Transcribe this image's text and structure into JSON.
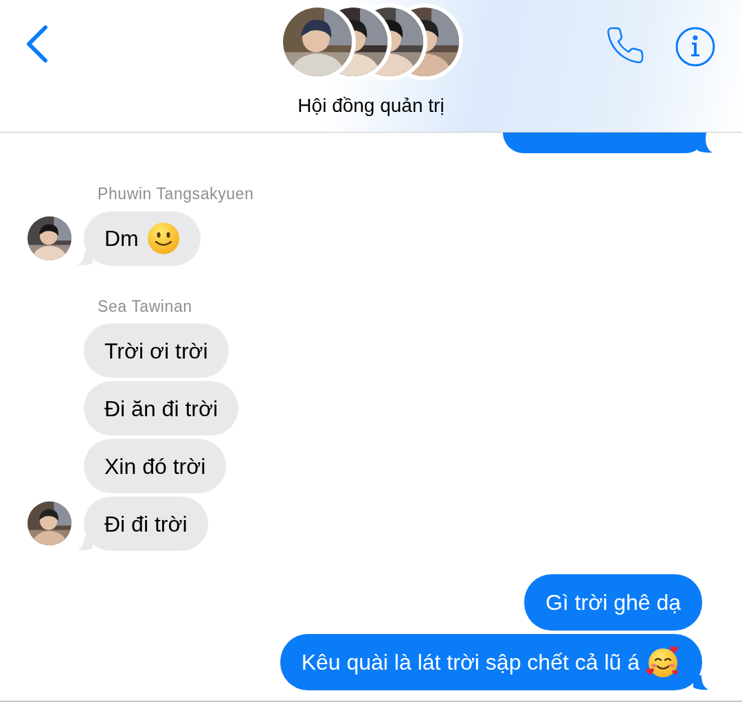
{
  "header": {
    "title": "Hội đồng quản trị"
  },
  "messages": [
    {
      "kind": "outgoing_partial"
    },
    {
      "kind": "sender",
      "text": "Phuwin Tangsakyuen"
    },
    {
      "kind": "incoming",
      "text": "Dm",
      "emoji": {
        "kind": "slight_smile"
      },
      "avatar": true,
      "tail": true
    },
    {
      "kind": "sender",
      "text": "Sea Tawinan"
    },
    {
      "kind": "incoming",
      "text": "Trời ơi trời",
      "avatar": false,
      "tail": false
    },
    {
      "kind": "incoming",
      "text": "Đi ăn đi trời",
      "avatar": false,
      "tail": false
    },
    {
      "kind": "incoming",
      "text": "Xin đó trời",
      "avatar": false,
      "tail": false
    },
    {
      "kind": "incoming",
      "text": "Đi đi trời",
      "avatar": true,
      "tail": true
    },
    {
      "kind": "outgoing",
      "text": "Gì trời ghê dạ",
      "tail": false
    },
    {
      "kind": "outgoing",
      "text": "Kêu quài là lát trời sập chết cả lũ á",
      "emoji": {
        "kind": "hearts"
      },
      "tail": true
    }
  ]
}
